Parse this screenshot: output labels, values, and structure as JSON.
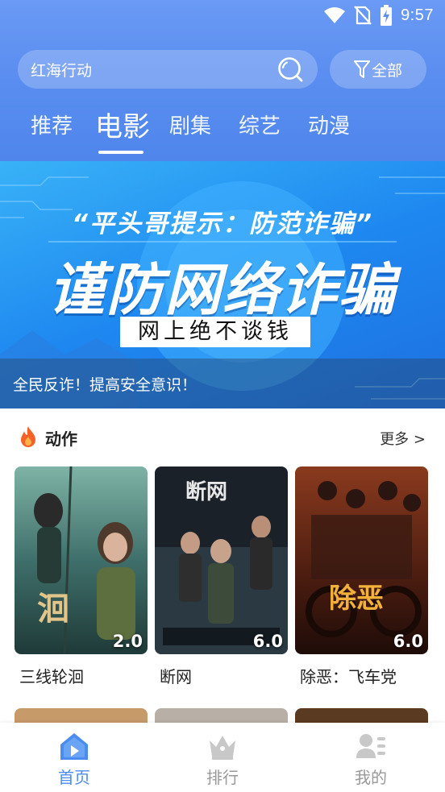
{
  "status_bar": {
    "time": "9:57"
  },
  "search": {
    "value": "红海行动"
  },
  "filter": {
    "label": "全部"
  },
  "tabs": [
    {
      "label": "推荐"
    },
    {
      "label": "电影"
    },
    {
      "label": "剧集"
    },
    {
      "label": "综艺"
    },
    {
      "label": "动漫"
    }
  ],
  "active_tab": "电影",
  "banner": {
    "quote": "“平头哥提示：防范诈骗”",
    "headline": "谨防网络诈骗",
    "sub": "网上绝不谈钱",
    "caption": "全民反诈！提高安全意识！"
  },
  "section": {
    "title": "动作",
    "more": "更多 >"
  },
  "movies": [
    {
      "title": "三线轮洄",
      "score": "2.0"
    },
    {
      "title": "断网",
      "score": "6.0"
    },
    {
      "title": "除恶：飞车党",
      "score": "6.0"
    }
  ],
  "poster_logos": {
    "movie_1": "洄",
    "movie_2": "断网",
    "movie_3": "除恶"
  },
  "bottom_nav": [
    {
      "label": "首页",
      "icon": "home-icon"
    },
    {
      "label": "排行",
      "icon": "crown-icon"
    },
    {
      "label": "我的",
      "icon": "profile-icon"
    }
  ],
  "colors": {
    "accent": "#4a8cf0",
    "header_top": "#6a9af5",
    "banner_blue": "#1e88f0"
  }
}
